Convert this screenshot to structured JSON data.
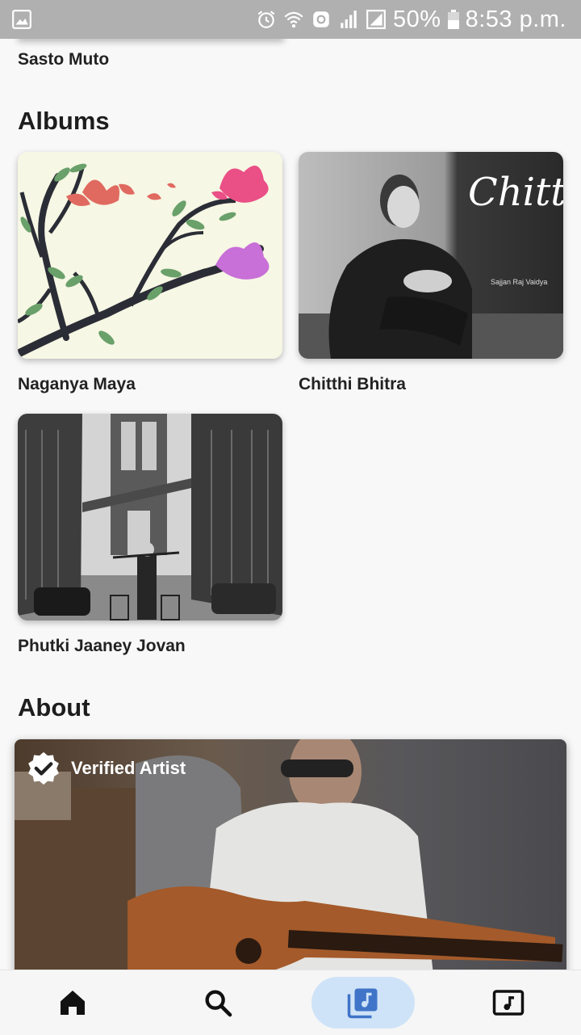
{
  "status_bar": {
    "battery": "50%",
    "time": "8:53 p.m.",
    "icons": [
      "gallery-icon",
      "alarm-icon",
      "wifi-icon",
      "data-saver-icon",
      "signal-icon",
      "signal-box-icon",
      "battery-icon"
    ]
  },
  "previous_section": {
    "last_item_title": "Sasto Muto"
  },
  "albums": {
    "heading": "Albums",
    "items": [
      {
        "title": "Naganya Maya",
        "art": "flowering-branch-illustration"
      },
      {
        "title": "Chitthi Bhitra",
        "art": "man-sitting-portrait",
        "art_text": "Chitthi Bhitra",
        "art_subtext": "Sajjan Raj Vaidya"
      },
      {
        "title": "Phutki Jaaney Jovan",
        "art": "bridge-street-photo"
      }
    ]
  },
  "about": {
    "heading": "About",
    "badge_label": "Verified Artist"
  },
  "bottom_nav": {
    "items": [
      {
        "name": "home",
        "icon": "home-icon"
      },
      {
        "name": "search",
        "icon": "search-icon"
      },
      {
        "name": "library",
        "icon": "library-music-icon",
        "active": true
      },
      {
        "name": "now-playing",
        "icon": "music-box-icon"
      }
    ],
    "active_color": "#cfe3f8",
    "active_icon_color": "#3f74c8"
  }
}
